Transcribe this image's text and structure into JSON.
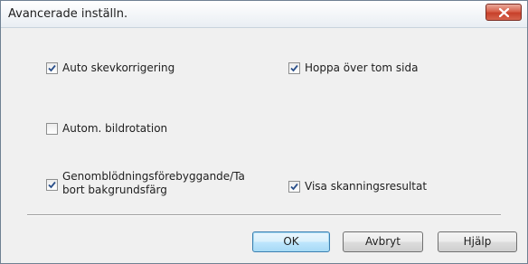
{
  "window": {
    "title": "Avancerade inställn."
  },
  "options": [
    {
      "label": "Auto skevkorrigering",
      "checked": true
    },
    {
      "label": "Hoppa över tom sida",
      "checked": true
    },
    {
      "label": "Autom. bildrotation",
      "checked": false
    },
    {
      "label": "Genomblödningsförebyggande/Ta bort bakgrundsfärg",
      "checked": true
    },
    {
      "label": "Visa skanningsresultat",
      "checked": true
    }
  ],
  "buttons": {
    "ok": "OK",
    "cancel": "Avbryt",
    "help": "Hjälp"
  },
  "icons": {
    "close": "close-icon",
    "check": "checkmark-icon"
  },
  "colors": {
    "close_button": "#c7402a",
    "default_button_border": "#3c7fb1",
    "check": "#2a4f8a"
  }
}
